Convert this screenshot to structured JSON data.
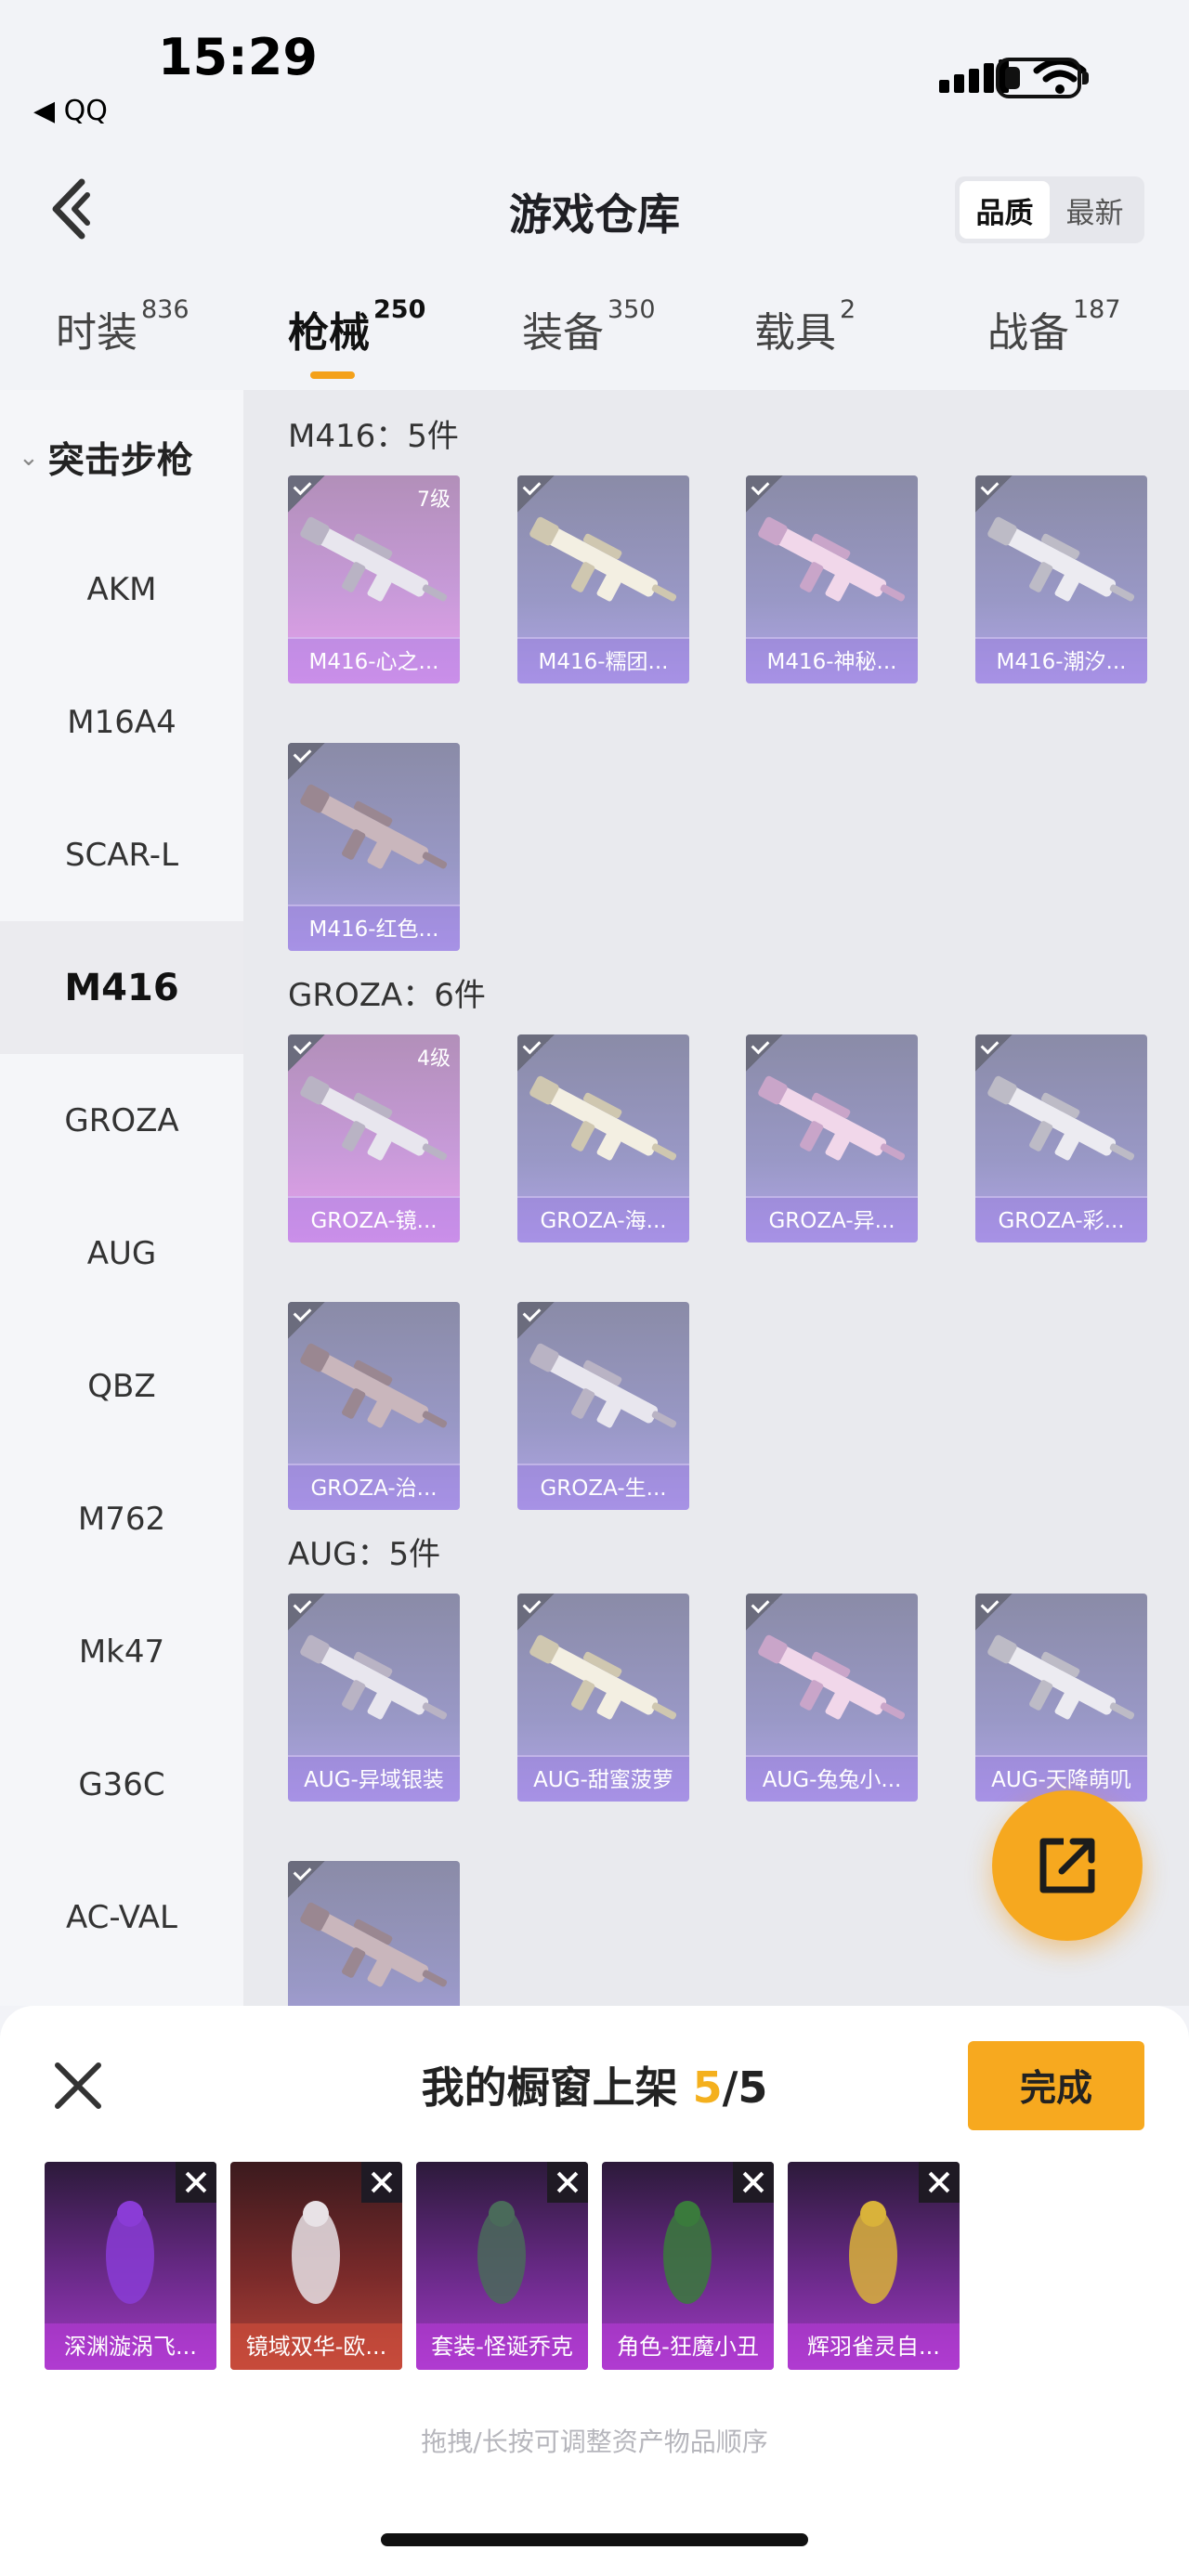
{
  "status_bar": {
    "time": "15:29",
    "back_app": "◀ QQ"
  },
  "nav": {
    "title": "游戏仓库",
    "sort_options": [
      "品质",
      "最新"
    ],
    "sort_selected": "品质"
  },
  "tabs": [
    {
      "label": "时装",
      "count": "836"
    },
    {
      "label": "枪械",
      "count": "250"
    },
    {
      "label": "装备",
      "count": "350"
    },
    {
      "label": "载具",
      "count": "2"
    },
    {
      "label": "战备",
      "count": "187"
    }
  ],
  "active_tab": "枪械",
  "sidebar": {
    "category": "突击步枪",
    "items": [
      "AKM",
      "M16A4",
      "SCAR-L",
      "M416",
      "GROZA",
      "AUG",
      "QBZ",
      "M762",
      "Mk47",
      "G36C",
      "AC-VAL"
    ],
    "selected": "M416"
  },
  "sections": [
    {
      "title": "M416：5件",
      "items": [
        {
          "name": "M416-心之...",
          "level": "7级",
          "quality": "pink"
        },
        {
          "name": "M416-糯团...",
          "level": "",
          "quality": "purple"
        },
        {
          "name": "M416-神秘...",
          "level": "",
          "quality": "purple"
        },
        {
          "name": "M416-潮汐...",
          "level": "",
          "quality": "purple"
        },
        {
          "name": "M416-红色...",
          "level": "",
          "quality": "purple"
        }
      ]
    },
    {
      "title": "GROZA：6件",
      "items": [
        {
          "name": "GROZA-镜...",
          "level": "4级",
          "quality": "pink"
        },
        {
          "name": "GROZA-海...",
          "level": "",
          "quality": "purple"
        },
        {
          "name": "GROZA-异...",
          "level": "",
          "quality": "purple"
        },
        {
          "name": "GROZA-彩...",
          "level": "",
          "quality": "purple"
        },
        {
          "name": "GROZA-治...",
          "level": "",
          "quality": "purple"
        },
        {
          "name": "GROZA-生...",
          "level": "",
          "quality": "purple"
        }
      ]
    },
    {
      "title": "AUG：5件",
      "items": [
        {
          "name": "AUG-异域银装",
          "level": "",
          "quality": "purple"
        },
        {
          "name": "AUG-甜蜜菠萝",
          "level": "",
          "quality": "purple"
        },
        {
          "name": "AUG-兔兔小...",
          "level": "",
          "quality": "purple"
        },
        {
          "name": "AUG-天降萌叽",
          "level": "",
          "quality": "purple"
        },
        {
          "name": "",
          "level": "",
          "quality": "purple"
        }
      ]
    }
  ],
  "showcase": {
    "title_prefix": "我的橱窗上架",
    "count": "5",
    "total": "/5",
    "done_label": "完成",
    "items": [
      {
        "name": "深渊漩涡飞...",
        "theme": "purple"
      },
      {
        "name": "镜域双华-欧...",
        "theme": "red"
      },
      {
        "name": "套装-怪诞乔克",
        "theme": "purple"
      },
      {
        "name": "角色-狂魔小丑",
        "theme": "purple"
      },
      {
        "name": "辉羽雀灵自...",
        "theme": "purple"
      }
    ],
    "hint": "拖拽/长按可调整资产物品顺序"
  },
  "colors": {
    "accent": "#f6a81f",
    "pink_quality": "#e7a1ec",
    "purple_quality": "#b1a6e6"
  }
}
